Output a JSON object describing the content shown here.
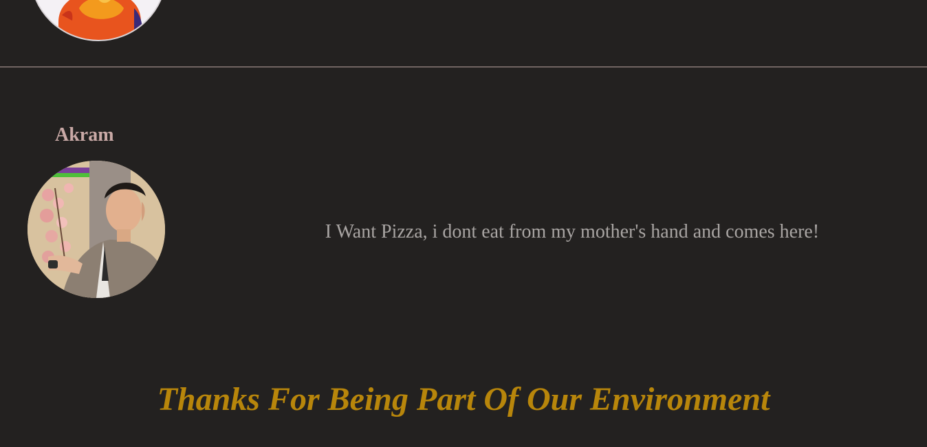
{
  "previous_review": {
    "avatar_icon": "cartoon-duck-avatar-icon"
  },
  "review": {
    "name": "Akram",
    "avatar_icon": "reviewer-photo-avatar",
    "text": "I Want Pizza, i dont eat from my mother's hand and comes here!"
  },
  "footer": {
    "thanks": "Thanks For Being Part Of Our Environment"
  },
  "colors": {
    "background": "#232120",
    "name": "#c9a9a6",
    "review_text": "#a9a5a3",
    "thanks": "#b8860b",
    "divider": "#b9a4a0"
  }
}
